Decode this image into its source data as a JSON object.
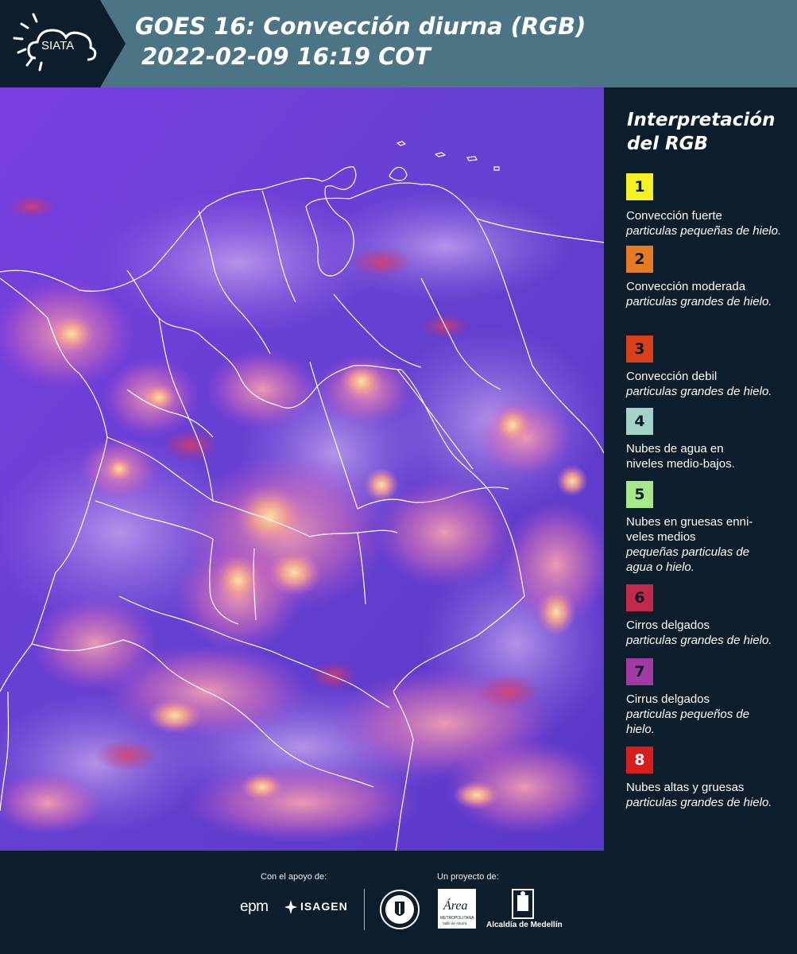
{
  "header": {
    "logo_text": "SIATA",
    "title_line1": "GOES 16: Convección diurna (RGB)",
    "title_line2": "2022-02-09 16:19 COT"
  },
  "legend": {
    "title_line1": "Interpretación",
    "title_line2": "del RGB",
    "items": [
      {
        "number": "1",
        "name": "Convección fuerte",
        "desc": "particulas pequeñas de hielo.",
        "color": "#f5f223"
      },
      {
        "number": "2",
        "name": "Convección moderada",
        "desc": "particulas grandes de hielo.",
        "color": "#e57b22"
      },
      {
        "number": "3",
        "name": "Convección debil",
        "desc": "particulas grandes de hielo.",
        "color": "#d9401a"
      },
      {
        "number": "4",
        "name": "Nubes de agua en niveles medio-bajos.",
        "desc": "",
        "color": "#a3d2c9"
      },
      {
        "number": "5",
        "name": "Nubes en gruesas enni-veles medios",
        "desc": "pequeñas particulas de agua o hielo.",
        "color": "#a6e88a"
      },
      {
        "number": "6",
        "name": "Cirros delgados",
        "desc": "particulas grandes de hielo.",
        "color": "#c2284c"
      },
      {
        "number": "7",
        "name": "Cirrus delgados",
        "desc": "particulas pequeños de hielo.",
        "color": "#a13aa2"
      },
      {
        "number": "8",
        "name": "Nubes altas y gruesas",
        "desc": "particulas grandes de hielo.",
        "color": "#d51f1f"
      }
    ]
  },
  "footer": {
    "support_label": "Con el apoyo de:",
    "project_label": "Un proyecto de:",
    "epm": "epm",
    "isagen": "ISAGEN",
    "area_logo_line1": "Área",
    "area_logo_line2": "METROPOLITANA",
    "area_logo_line3": "Valle de Aburrá",
    "alcaldia": "Alcaldía de Medellín"
  },
  "colors": {
    "header_bg": "#4b7585",
    "page_bg": "#0c1e2b",
    "map_base": "#6a3fd4"
  }
}
